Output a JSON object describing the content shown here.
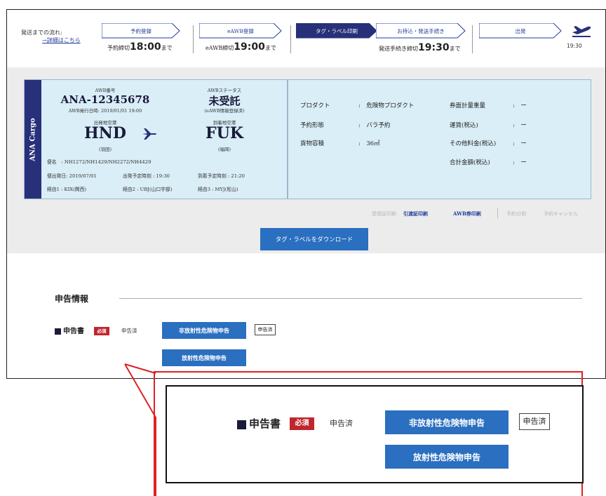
{
  "flow": {
    "label": "発送までの流れ:",
    "link": "→詳細はこちら",
    "steps": [
      {
        "title": "予約登録",
        "deadline_prefix": "予約締切",
        "deadline_time": "18:00",
        "deadline_suffix": "まで"
      },
      {
        "title": "eAWB登録",
        "deadline_prefix": "eAWB締切",
        "deadline_time": "19:00",
        "deadline_suffix": "まで"
      },
      {
        "title": "タグ・ラベル印刷",
        "deadline_prefix": "発送手続き締切",
        "deadline_time": "19:30",
        "deadline_suffix": "まで"
      },
      {
        "title": "お持込・発送手続き"
      },
      {
        "title": "出発"
      }
    ],
    "departure_time": "19:30",
    "plane_icon": "airplane-takeoff-icon"
  },
  "awb": {
    "side_label": "ANA Cargo",
    "number_label": "AWB番号",
    "number": "ANA-12345678",
    "issue": "AWB発行日時: 2019/01/01 19:00",
    "status_label": "AWBステータス",
    "status": "未受託",
    "status_note": "(eAWB情報登録済)",
    "origin_label": "出発地空港",
    "origin": "HND",
    "origin_name": "(羽田)",
    "dest_label": "到着地空港",
    "dest": "FUK",
    "dest_name": "(福岡)",
    "flight": "便名　: NH1272/NH1429/NH2272/NH4429",
    "dep_date": "便出発日: 2019/07/01",
    "dep_time": "出発予定時刻 : 19:30",
    "arr_time": "到着予定時刻 : 21:20",
    "via1": "経由1 : KIX(関西)",
    "via2": "経由2 : UBJ(山口宇部)",
    "via3": "経由3 : MYJ(松山)"
  },
  "info": {
    "product_label": "プロダクト",
    "product_value": ":　危険物プロダクト",
    "reserve_label": "予約形態",
    "reserve_value": ":　バラ予約",
    "volume_label": "貨物容積",
    "volume_value": ":　36㎥",
    "weight_label": "券面計量重量",
    "weight_value": ":　ー",
    "fare_label": "運賃(税込)",
    "fare_value": ":　ー",
    "other_label": "その他料金(税込)",
    "other_value": ":　ー",
    "total_label": "合計金額(税込)",
    "total_value": ":　ー"
  },
  "actions": {
    "receipt": "受領証印刷",
    "handover": "引渡証印刷",
    "awb_print": "AWB券印刷",
    "split": "予約分割",
    "cancel": "予約キャンセル",
    "download": "タグ・ラベルをダウンロード"
  },
  "declaration": {
    "section_title": "申告情報",
    "doc_label": "申告書",
    "required": "必須",
    "done_text": "申告済",
    "non_radio_btn": "非放射性危険物申告",
    "done_box": "申告済",
    "radio_btn": "放射性危険物申告"
  },
  "colors": {
    "navy": "#28307a",
    "blue_button": "#2a6fc0",
    "card_bg": "#d9eef7",
    "required_red": "#c0262d",
    "callout_red": "#dd2222"
  }
}
